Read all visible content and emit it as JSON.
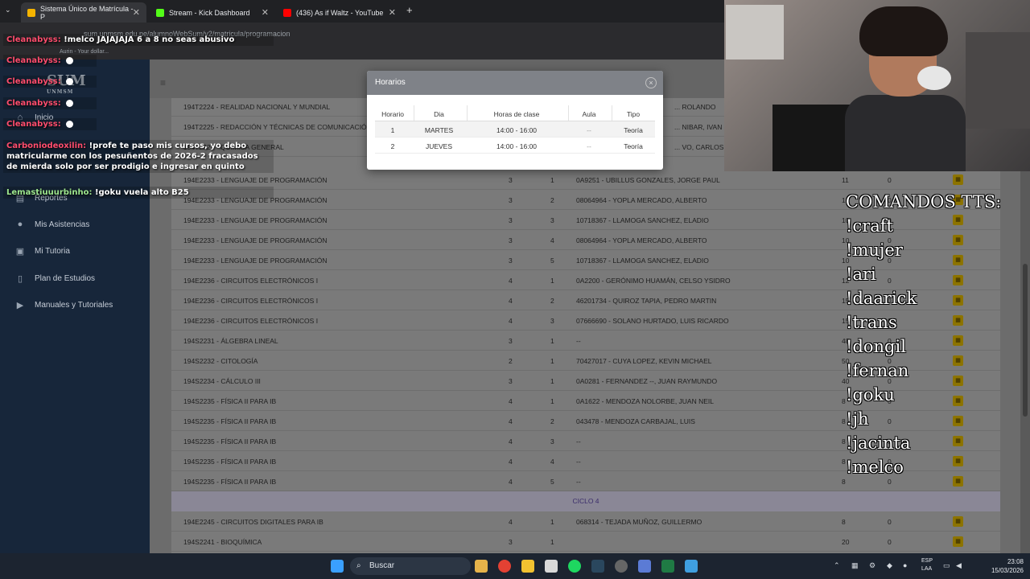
{
  "browser": {
    "tabs": [
      {
        "title": "Sistema Único de Matrícula - P",
        "color": "#f5b400"
      },
      {
        "title": "Stream - Kick Dashboard",
        "color": "#53fc18"
      },
      {
        "title": "(436) As if Waltz - YouTube",
        "color": "#ff0000"
      }
    ],
    "new_tab": "+",
    "url": "sum.unmsm.edu.pe/alumnoWebSum/v2/matricula/programacion",
    "bookmark": "Aurin - Your dollar..."
  },
  "sidebar": {
    "logo": "SUM",
    "logo_sub": "UNMSM",
    "items": [
      {
        "label": "Inicio",
        "icon": "home-icon"
      },
      {
        "label": "Reportes",
        "icon": "report-icon"
      },
      {
        "label": "Mis Asistencias",
        "icon": "user-icon"
      },
      {
        "label": "Mi Tutoria",
        "icon": "person-board-icon"
      },
      {
        "label": "Plan de Estudios",
        "icon": "book-icon"
      },
      {
        "label": "Manuales y Tutoriales",
        "icon": "video-icon"
      }
    ]
  },
  "table": {
    "rows_top": [
      {
        "course": "194T2224 - REALIDAD NACIONAL Y MUNDIAL",
        "teacher": "... ROLANDO"
      },
      {
        "course": "194T2225 - REDACCIÓN Y TÉCNICAS DE COMUNICACIÓN",
        "teacher": "... NIBAR, IVAN ERNE"
      },
      {
        "course": "194T2226 - QUÍMICA GENERAL",
        "teacher": "... VO, CARLOS"
      }
    ],
    "rows": [
      {
        "course": "194E2233 - LENGUAJE DE PROGRAMACIÓN",
        "cred": "3",
        "sec": "1",
        "teacher": "0A9251 - UBILLUS GONZALES, JORGE PAUL",
        "vac": "11",
        "mat": "0"
      },
      {
        "course": "194E2233 - LENGUAJE DE PROGRAMACIÓN",
        "cred": "3",
        "sec": "2",
        "teacher": "08064964 - YOPLA MERCADO, ALBERTO",
        "vac": "10",
        "mat": "0"
      },
      {
        "course": "194E2233 - LENGUAJE DE PROGRAMACIÓN",
        "cred": "3",
        "sec": "3",
        "teacher": "10718367 - LLAMOGA SANCHEZ, ELADIO",
        "vac": "10",
        "mat": "0"
      },
      {
        "course": "194E2233 - LENGUAJE DE PROGRAMACIÓN",
        "cred": "3",
        "sec": "4",
        "teacher": "08064964 - YOPLA MERCADO, ALBERTO",
        "vac": "10",
        "mat": "0"
      },
      {
        "course": "194E2233 - LENGUAJE DE PROGRAMACIÓN",
        "cred": "3",
        "sec": "5",
        "teacher": "10718367 - LLAMOGA SANCHEZ, ELADIO",
        "vac": "10",
        "mat": "0"
      },
      {
        "course": "194E2236 - CIRCUITOS ELECTRÓNICOS I",
        "cred": "4",
        "sec": "1",
        "teacher": "0A2200 - GERÓNIMO HUAMÁN, CELSO YSIDRO",
        "vac": "12",
        "mat": "0"
      },
      {
        "course": "194E2236 - CIRCUITOS ELECTRÓNICOS I",
        "cred": "4",
        "sec": "2",
        "teacher": "46201734 - QUIROZ TAPIA, PEDRO MARTIN",
        "vac": "15",
        "mat": "0"
      },
      {
        "course": "194E2236 - CIRCUITOS ELECTRÓNICOS I",
        "cred": "4",
        "sec": "3",
        "teacher": "07666690 - SOLANO HURTADO, LUIS RICARDO",
        "vac": "15",
        "mat": "0"
      },
      {
        "course": "194S2231 - ÁLGEBRA LINEAL",
        "cred": "3",
        "sec": "1",
        "teacher": "--",
        "vac": "48",
        "mat": "0"
      },
      {
        "course": "194S2232 - CITOLOGÍA",
        "cred": "2",
        "sec": "1",
        "teacher": "70427017 - CUYA LOPEZ, KEVIN MICHAEL",
        "vac": "50",
        "mat": "0"
      },
      {
        "course": "194S2234 - CÁLCULO III",
        "cred": "3",
        "sec": "1",
        "teacher": "0A0281 - FERNANDEZ --, JUAN RAYMUNDO",
        "vac": "40",
        "mat": "0"
      },
      {
        "course": "194S2235 - FÍSICA II PARA IB",
        "cred": "4",
        "sec": "1",
        "teacher": "0A1622 - MENDOZA NOLORBE, JUAN NEIL",
        "vac": "8",
        "mat": "0"
      },
      {
        "course": "194S2235 - FÍSICA II PARA IB",
        "cred": "4",
        "sec": "2",
        "teacher": "043478 - MENDOZA CARBAJAL, LUIS",
        "vac": "8",
        "mat": "0"
      },
      {
        "course": "194S2235 - FÍSICA II PARA IB",
        "cred": "4",
        "sec": "3",
        "teacher": "--",
        "vac": "8",
        "mat": "0"
      },
      {
        "course": "194S2235 - FÍSICA II PARA IB",
        "cred": "4",
        "sec": "4",
        "teacher": "--",
        "vac": "8",
        "mat": "0"
      },
      {
        "course": "194S2235 - FÍSICA II PARA IB",
        "cred": "4",
        "sec": "5",
        "teacher": "--",
        "vac": "8",
        "mat": "0"
      }
    ],
    "cycle_label": "CICLO 4",
    "rows_after": [
      {
        "course": "194E2245 - CIRCUITOS DIGITALES PARA IB",
        "cred": "4",
        "sec": "1",
        "teacher": "068314 - TEJADA MUÑOZ, GUILLERMO",
        "vac": "8",
        "mat": "0"
      },
      {
        "course": "194S2241 - BIOQUÍMICA",
        "cred": "3",
        "sec": "1",
        "teacher": "",
        "vac": "20",
        "mat": "0"
      }
    ]
  },
  "modal": {
    "title": "Horarios",
    "close": "×",
    "headers": [
      "Horario",
      "Dia",
      "Horas de clase",
      "Aula",
      "Tipo"
    ],
    "rows": [
      [
        "1",
        "MARTES",
        "14:00 - 16:00",
        "--",
        "Teoría"
      ],
      [
        "2",
        "JUEVES",
        "14:00 - 16:00",
        "--",
        "Teoría"
      ]
    ]
  },
  "chat": [
    {
      "user": "Cleanabyss:",
      "msg": "!melco JAJAJAJA 6 a 8 no seas abusivo",
      "badge": false
    },
    {
      "user": "Cleanabyss:",
      "msg": "",
      "badge": true
    },
    {
      "user": "Cleanabyss:",
      "msg": "",
      "badge": true
    },
    {
      "user": "Cleanabyss:",
      "msg": "",
      "badge": true
    },
    {
      "user": "Cleanabyss:",
      "msg": "",
      "badge": true
    },
    {
      "user": "Carboniodeoxilin:",
      "msg": "!profe te paso mis cursos, yo debo matricularme con los pesuñentos de 2026-2 fracasados de mierda solo por ser prodigio e ingresar en quinto",
      "badge": false
    },
    {
      "user": "Lemastiuuurbinho:",
      "msg": "!goku vuela alto B25",
      "badge": false
    }
  ],
  "tts": {
    "title": "COMANDOS TTS:",
    "commands": [
      "!craft",
      "!mujer",
      "!ari",
      "!daarick",
      "!trans",
      "!dongil",
      "!fernan",
      "!goku",
      "!jh",
      "!jacinta",
      "!melco"
    ]
  },
  "taskbar": {
    "search_label": "Buscar",
    "lang_line1": "ESP",
    "lang_line2": "LAA",
    "time": "23:08",
    "date": "15/03/2026"
  }
}
